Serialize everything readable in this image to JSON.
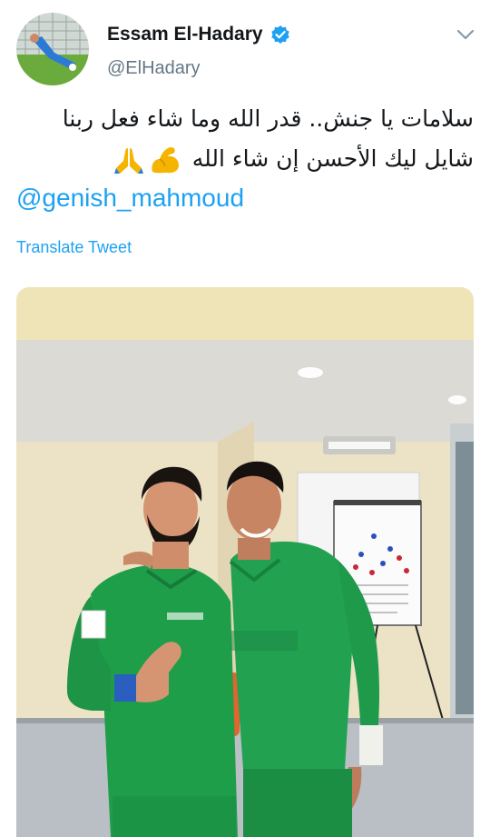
{
  "tweet": {
    "author": {
      "display_name": "Essam El-Hadary",
      "handle": "@ElHadary",
      "verified": true
    },
    "text_lines": [
      "سلامات يا جنش.. قدر الله وما شاء فعل ربنا",
      "شايل ليك الأحسن إن شاء الله"
    ],
    "emojis": [
      "flexed-biceps",
      "folded-hands"
    ],
    "mention": "@genish_mahmoud",
    "translate_label": "Translate Tweet"
  },
  "theme": {
    "link_color": "#1da1f2",
    "verified_color": "#1da1f2",
    "text_color": "#14171a",
    "muted_color": "#657786",
    "jersey_green": "#1f9e4a"
  }
}
